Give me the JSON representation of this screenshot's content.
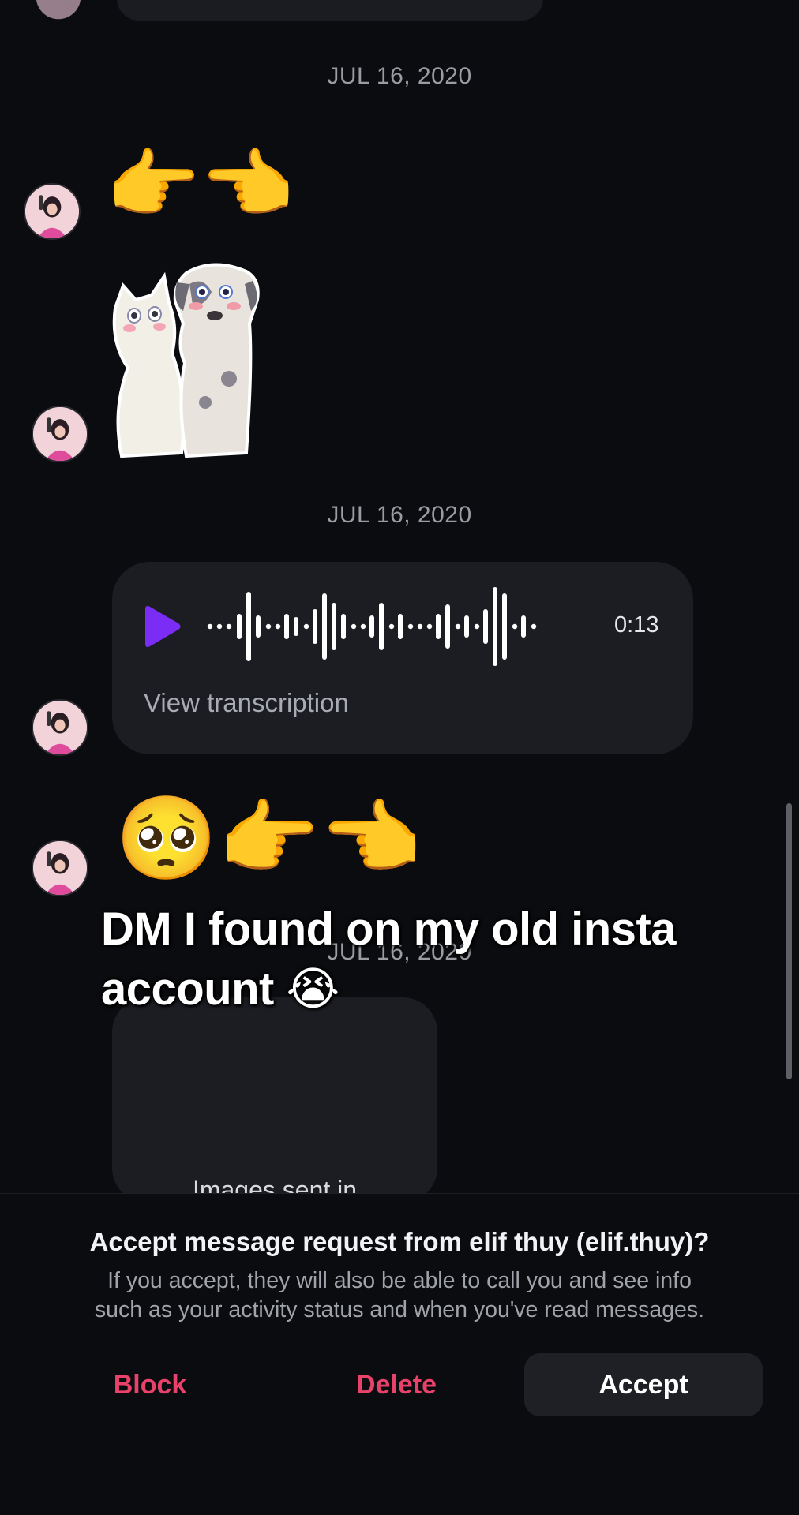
{
  "chat": {
    "dates": [
      "JUL 16, 2020",
      "JUL 16, 2020",
      "JUL 16, 2020"
    ],
    "messages": {
      "emoji_1": "👉👈",
      "emoji_2": "🥺👉👈",
      "sticker": "cat-and-puppy-sticker",
      "voice": {
        "duration": "0:13",
        "transcription_label": "View transcription",
        "play_color": "#7b2cf5"
      },
      "image_placeholder": "Images sent in"
    }
  },
  "overlay_caption": {
    "line1": "DM I found on my old insta",
    "line2": "account 😭"
  },
  "request": {
    "title": "Accept message request from elif thuy (elif.thuy)?",
    "body_line1": "If you accept, they will also be able to call you and see info",
    "body_line2": "such as your activity status and when you've read messages.",
    "block_label": "Block",
    "delete_label": "Delete",
    "accept_label": "Accept",
    "danger_color": "#e8426b"
  }
}
